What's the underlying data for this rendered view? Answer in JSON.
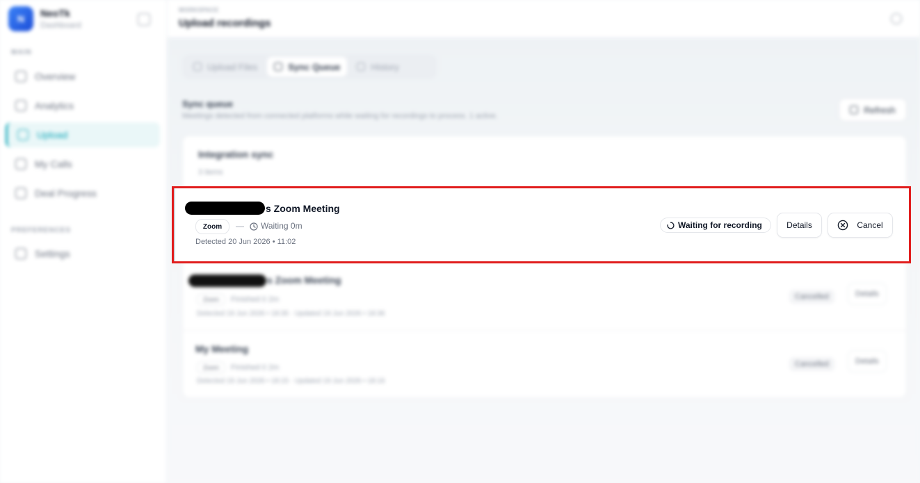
{
  "sidebar": {
    "brand_name": "NeoTk",
    "brand_sub": "Dashboard",
    "logo_initial": "N",
    "section_main": "MAIN",
    "section_prefs": "PREFERENCES",
    "items": [
      {
        "label": "Overview"
      },
      {
        "label": "Analytics"
      },
      {
        "label": "Upload"
      },
      {
        "label": "My Calls"
      },
      {
        "label": "Deal Progress"
      },
      {
        "label": "Settings"
      }
    ]
  },
  "header": {
    "breadcrumb": "WORKSPACE",
    "title": "Upload recordings"
  },
  "tabs": [
    {
      "label": "Upload Files"
    },
    {
      "label": "Sync Queue"
    },
    {
      "label": "History"
    }
  ],
  "queue": {
    "title": "Sync queue",
    "description": "Meetings detected from connected platforms while waiting for recordings to process. 1 active.",
    "refresh_label": "Refresh",
    "card_title": "Integration sync",
    "card_count": "3 items"
  },
  "active_item": {
    "title_suffix": "s Zoom Meeting",
    "platform": "Zoom",
    "dash": "—",
    "waiting": "Waiting 0m",
    "detected": "Detected 20 Jun 2026 • 11:02",
    "status": "Waiting for recording",
    "details_label": "Details",
    "cancel_label": "Cancel"
  },
  "other_items": [
    {
      "title_suffix": "s Zoom Meeting",
      "platform": "Zoom",
      "meta": "Finished 0 2m",
      "dates": "Detected 19 Jun 2026 • 18:35 · Updated 19 Jun 2026 • 18:36",
      "status": "Cancelled",
      "details_label": "Details"
    },
    {
      "title": "My Meeting",
      "platform": "Zoom",
      "meta": "Finished 0 2m",
      "dates": "Detected 19 Jun 2026 • 18:15 · Updated 19 Jun 2026 • 18:16",
      "status": "Cancelled",
      "details_label": "Details"
    }
  ],
  "colors": {
    "accent": "#0ea5b7",
    "highlight": "#e11d1d",
    "redaction": "#000000"
  }
}
